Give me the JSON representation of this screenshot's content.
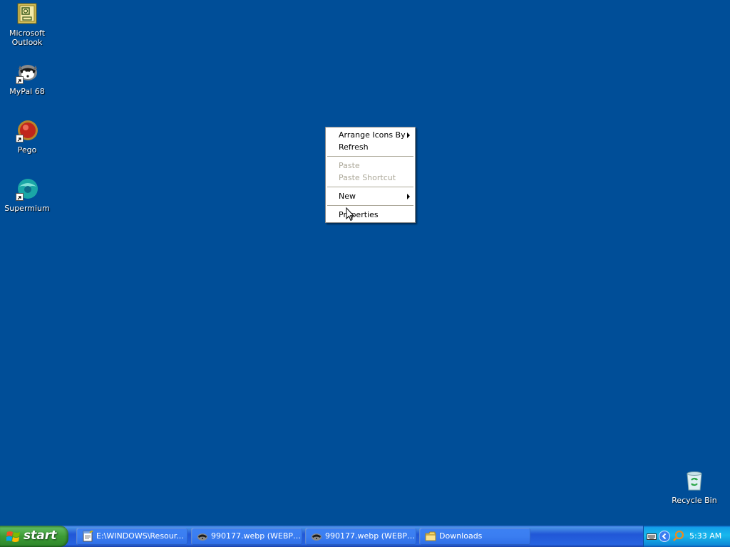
{
  "desktop": {
    "background_color": "#004e98",
    "icons": [
      {
        "label": "Microsoft\nOutlook",
        "icon": "outlook-icon"
      },
      {
        "label": "MyPal 68",
        "icon": "mypal-icon"
      },
      {
        "label": "Pego",
        "icon": "pego-icon"
      },
      {
        "label": "Supermium",
        "icon": "supermium-icon"
      },
      {
        "label": "Recycle Bin",
        "icon": "recycle-bin-icon"
      }
    ]
  },
  "context_menu": {
    "items": [
      {
        "label": "Arrange Icons By",
        "submenu": true,
        "enabled": true
      },
      {
        "label": "Refresh",
        "submenu": false,
        "enabled": true
      },
      {
        "label": "Paste",
        "submenu": false,
        "enabled": false
      },
      {
        "label": "Paste Shortcut",
        "submenu": false,
        "enabled": false
      },
      {
        "label": "New",
        "submenu": true,
        "enabled": true
      },
      {
        "label": "Properties",
        "submenu": false,
        "enabled": true
      }
    ]
  },
  "taskbar": {
    "start_label": "start",
    "tasks": [
      {
        "label": "E:\\WINDOWS\\Resour...",
        "icon": "notepad-icon"
      },
      {
        "label": "990177.webp (WEBP ...",
        "icon": "image-viewer-icon"
      },
      {
        "label": "990177.webp (WEBP ...",
        "icon": "image-viewer-icon"
      },
      {
        "label": "Downloads",
        "icon": "folder-icon"
      }
    ],
    "tray": {
      "clock": "5:33 AM",
      "icons": [
        "keyboard-icon",
        "expand-tray-icon",
        "search-icon"
      ]
    }
  }
}
